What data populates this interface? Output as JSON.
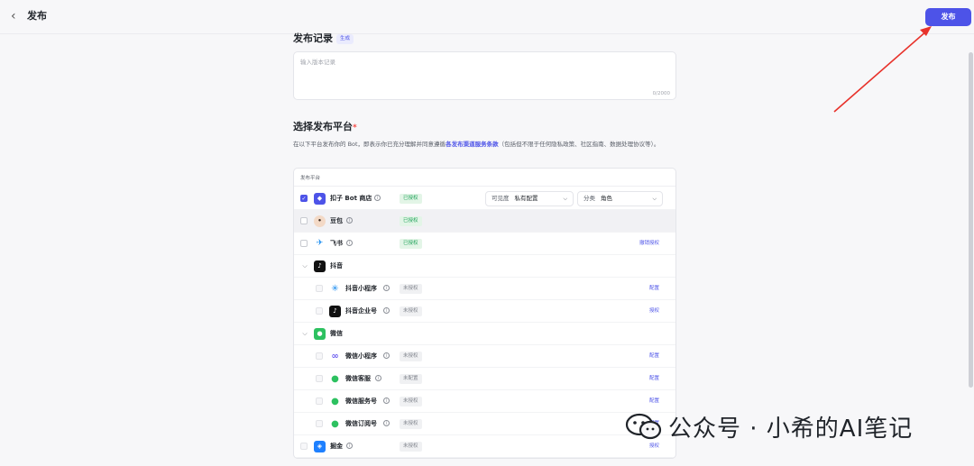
{
  "header": {
    "back_icon": "chevron-left-icon",
    "title": "发布",
    "publish_label": "发布"
  },
  "release_notes": {
    "title": "发布记录",
    "generate_label": "生成",
    "placeholder": "输入版本记录",
    "counter": "0/2000"
  },
  "platforms": {
    "title": "选择发布平台",
    "required_mark": "*",
    "desc_before": "在以下平台发布你的 Bot，即表示你已充分理解并同意遵循",
    "desc_link": "各发布渠道服务条款",
    "desc_after": "（包括但不限于任何隐私政策、社区指南、数据处理协议等）。",
    "column_header": "发布平台",
    "visibility": {
      "label": "可见度",
      "value": "私有配置"
    },
    "category": {
      "label": "分类",
      "value": "角色"
    },
    "rows": [
      {
        "name": "扣子 Bot 商店",
        "status": "已授权",
        "action": "",
        "icon": "coze-store-icon",
        "checked": true
      },
      {
        "name": "豆包",
        "status": "已授权",
        "action": "",
        "icon": "doubao-icon",
        "checked": false
      },
      {
        "name": "飞书",
        "status": "已授权",
        "action": "撤销授权",
        "icon": "feishu-icon",
        "checked": false
      },
      {
        "name": "抖音",
        "status": "",
        "action": "",
        "icon": "douyin-icon",
        "group": true
      },
      {
        "name": "抖音小程序",
        "status": "未授权",
        "action": "配置",
        "icon": "douyin-miniapp-icon"
      },
      {
        "name": "抖音企业号",
        "status": "未授权",
        "action": "授权",
        "icon": "douyin-enterprise-icon"
      },
      {
        "name": "微信",
        "status": "",
        "action": "",
        "icon": "wechat-icon",
        "group": true
      },
      {
        "name": "微信小程序",
        "status": "未授权",
        "action": "配置",
        "icon": "wechat-miniapp-icon"
      },
      {
        "name": "微信客服",
        "status": "未配置",
        "action": "配置",
        "icon": "wechat-service-icon"
      },
      {
        "name": "微信服务号",
        "status": "未授权",
        "action": "配置",
        "icon": "wechat-service-account-icon"
      },
      {
        "name": "微信订阅号",
        "status": "未授权",
        "action": "配置",
        "icon": "wechat-subscription-icon"
      },
      {
        "name": "掘金",
        "status": "未授权",
        "action": "授权",
        "icon": "juejin-icon",
        "checked": false
      }
    ]
  },
  "watermark": "公众号 · 小希的AI笔记",
  "colors": {
    "accent": "#4d53e8",
    "authorized": "#20a35a",
    "annotation_arrow": "#e8322b"
  }
}
